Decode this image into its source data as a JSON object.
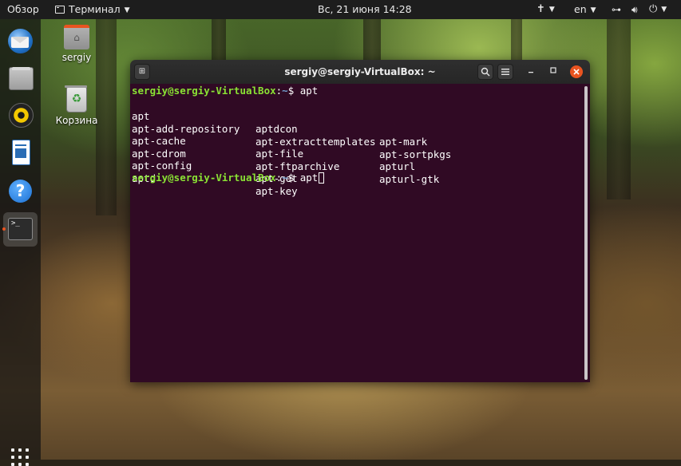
{
  "topbar": {
    "activities": "Обзор",
    "app_menu": "Терминал",
    "clock": "Вс, 21 июня  14:28",
    "language": "en"
  },
  "dock": {
    "items": [
      {
        "icon": "thunderbird-icon"
      },
      {
        "icon": "files-icon"
      },
      {
        "icon": "rhythmbox-icon"
      },
      {
        "icon": "libreoffice-writer-icon"
      },
      {
        "icon": "help-icon"
      },
      {
        "icon": "terminal-icon",
        "active": true,
        "glyph": ">_"
      }
    ],
    "show_apps_icon": "apps-grid-icon"
  },
  "desktop": {
    "icons": [
      {
        "label": "sergiy",
        "icon": "home-folder-icon"
      },
      {
        "label": "Корзина",
        "icon": "trash-icon"
      }
    ]
  },
  "terminal": {
    "title": "sergiy@sergiy-VirtualBox: ~",
    "prompt_user": "sergiy@sergiy-VirtualBox",
    "prompt_sep": ":",
    "prompt_path": "~",
    "prompt_sym": "$ ",
    "command": "apt",
    "completions": [
      [
        "apt",
        "aptdcon",
        "apt-mark"
      ],
      [
        "apt-add-repository",
        "apt-extracttemplates",
        "apt-sortpkgs"
      ],
      [
        "apt-cache",
        "apt-file",
        "apturl"
      ],
      [
        "apt-cdrom",
        "apt-ftparchive",
        "apturl-gtk"
      ],
      [
        "apt-config",
        "apt-get",
        ""
      ],
      [
        "aptd",
        "apt-key",
        ""
      ]
    ],
    "current_input": "apt"
  },
  "colors": {
    "terminal_bg": "#300a24",
    "prompt_user": "#8ae234",
    "prompt_path": "#729fcf",
    "close_button": "#e95420",
    "topbar_bg": "#1d1d1d"
  }
}
